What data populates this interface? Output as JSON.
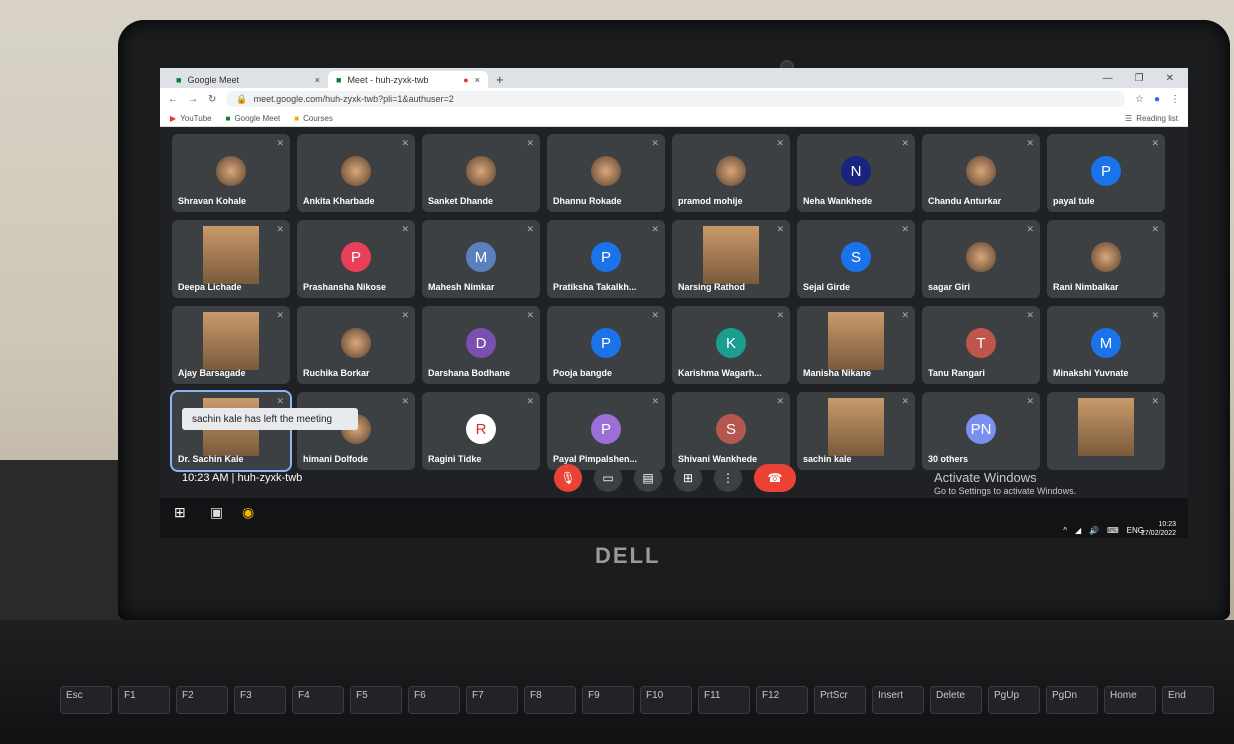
{
  "browser": {
    "tabs": [
      {
        "label": "Google Meet",
        "active": false
      },
      {
        "label": "Meet - huh-zyxk-twb",
        "active": true
      }
    ],
    "url": "meet.google.com/huh-zyxk-twb?pli=1&authuser=2",
    "bookmarks": [
      "YouTube",
      "Google Meet",
      "Courses"
    ],
    "reading_list": "Reading list"
  },
  "participants": [
    {
      "name": "Shravan Kohale",
      "avatar": "photo"
    },
    {
      "name": "Ankita Kharbade",
      "avatar": "photo"
    },
    {
      "name": "Sanket Dhande",
      "avatar": "photo"
    },
    {
      "name": "Dhannu Rokade",
      "avatar": "photo"
    },
    {
      "name": "pramod mohije",
      "avatar": "photo"
    },
    {
      "name": "Neha Wankhede",
      "avatar": "N",
      "color": "#1a237e"
    },
    {
      "name": "Chandu Anturkar",
      "avatar": "photo"
    },
    {
      "name": "payal tule",
      "avatar": "P",
      "color": "#1a73e8"
    },
    {
      "name": "Deepa Lichade",
      "avatar": "video"
    },
    {
      "name": "Prashansha Nikose",
      "avatar": "P",
      "color": "#e8405b"
    },
    {
      "name": "Mahesh Nimkar",
      "avatar": "M",
      "color": "#5b7fbd"
    },
    {
      "name": "Pratiksha Takalkh...",
      "avatar": "P",
      "color": "#1a73e8"
    },
    {
      "name": "Narsing Rathod",
      "avatar": "video"
    },
    {
      "name": "Sejal Girde",
      "avatar": "S",
      "color": "#1a73e8"
    },
    {
      "name": "sagar Giri",
      "avatar": "photo"
    },
    {
      "name": "Rani Nimbalkar",
      "avatar": "photo"
    },
    {
      "name": "Ajay Barsagade",
      "avatar": "video"
    },
    {
      "name": "Ruchika Borkar",
      "avatar": "photo"
    },
    {
      "name": "Darshana Bodhane",
      "avatar": "D",
      "color": "#7b4fb0"
    },
    {
      "name": "Pooja bangde",
      "avatar": "P",
      "color": "#1a73e8"
    },
    {
      "name": "Karishma Wagarh...",
      "avatar": "K",
      "color": "#1b9e8f"
    },
    {
      "name": "Manisha Nikane",
      "avatar": "video"
    },
    {
      "name": "Tanu Rangari",
      "avatar": "T",
      "color": "#c0564b"
    },
    {
      "name": "Minakshi Yuvnate",
      "avatar": "M",
      "color": "#1a73e8"
    },
    {
      "name": "Dr. Sachin Kale",
      "avatar": "video",
      "selected": true
    },
    {
      "name": "himani Dolfode",
      "avatar": "photo"
    },
    {
      "name": "Ragini Tidke",
      "avatar": "R",
      "color": "#ffffff"
    },
    {
      "name": "Payal Pimpalshen...",
      "avatar": "P",
      "color": "#9c6fd6"
    },
    {
      "name": "Shivani Wankhede",
      "avatar": "S",
      "color": "#b3574f"
    },
    {
      "name": "sachin kale",
      "avatar": "video"
    },
    {
      "name": "30 others",
      "avatar": "PN",
      "color": "#7b8ff0"
    },
    {
      "name": "",
      "avatar": "video"
    }
  ],
  "toast": "sachin kale has left the meeting",
  "meeting": {
    "time": "10:23 AM",
    "code": "huh-zyxk-twb"
  },
  "windows": {
    "activate_title": "Activate Windows",
    "activate_sub": "Go to Settings to activate Windows.",
    "tray_lang": "ENG",
    "clock_time": "10:23",
    "clock_date": "27/02/2022"
  },
  "laptop_brand": "DELL",
  "keyboard_keys": [
    "Esc",
    "F1",
    "F2",
    "F3",
    "F4",
    "F5",
    "F6",
    "F7",
    "F8",
    "F9",
    "F10",
    "F11",
    "F12",
    "PrtScr",
    "Insert",
    "Delete",
    "PgUp",
    "PgDn",
    "Home",
    "End"
  ]
}
